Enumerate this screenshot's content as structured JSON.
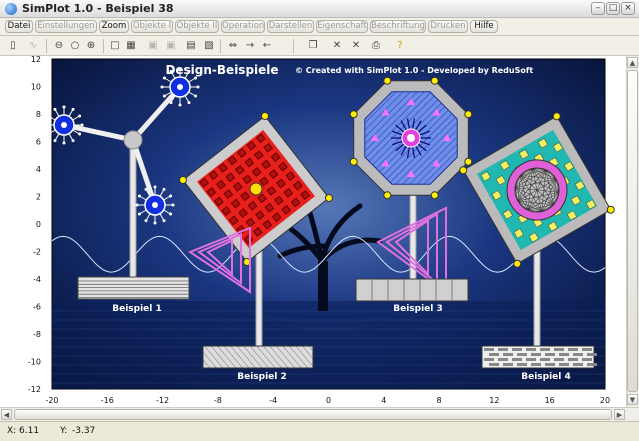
{
  "window": {
    "title": "SimPlot 1.0 - Beispiel 38"
  },
  "menu": {
    "items": [
      {
        "label": "Datei",
        "enabled": true
      },
      {
        "label": "Einstellungen",
        "enabled": false
      },
      {
        "label": "Zoom",
        "enabled": true
      },
      {
        "label": "Objekte I",
        "enabled": false
      },
      {
        "label": "Objekte II",
        "enabled": false
      },
      {
        "label": "Operation",
        "enabled": false
      },
      {
        "label": "Darstellen",
        "enabled": false
      },
      {
        "label": "Eigenschaft",
        "enabled": false
      },
      {
        "label": "Beschriftung",
        "enabled": false
      },
      {
        "label": "Drucken",
        "enabled": false
      },
      {
        "label": "Hilfe",
        "enabled": true
      }
    ]
  },
  "toolbar": {
    "icons": [
      "phone-icon",
      "wave-icon",
      "zoom-out-icon",
      "zoom-fit-icon",
      "zoom-in-icon",
      "square-icon",
      "grid-icon",
      "layers-icon",
      "layers2-icon",
      "table-icon",
      "picture-icon",
      "move-icon",
      "arrow-right-icon",
      "arrow-left-icon",
      "copy-icon",
      "delete-icon",
      "delete2-icon",
      "print-icon",
      "help-icon"
    ]
  },
  "plot": {
    "title": "Design-Beispiele",
    "credit": "© Created with SimPlot 1.0 - Developed by ReduSoft",
    "labels": [
      "Beispiel 1",
      "Beispiel 2",
      "Beispiel 3",
      "Beispiel 4"
    ],
    "x_ticks": [
      "-20",
      "-16",
      "-12",
      "-8",
      "-4",
      "0",
      "4",
      "8",
      "12",
      "16",
      "20"
    ],
    "y_ticks": [
      "12",
      "10",
      "8",
      "6",
      "4",
      "2",
      "0",
      "-2",
      "-4",
      "-6",
      "-8",
      "-10",
      "-12"
    ],
    "xlim": [
      -20,
      20
    ],
    "ylim": [
      -12,
      12
    ],
    "colors": {
      "background": "#0a1a4a",
      "square": "#e8201c",
      "octagon": "#4a6ad8",
      "diamond": "#20b8b0",
      "triangle": "#e070e0"
    }
  },
  "status": {
    "x_label": "X:",
    "x_value": "6.11",
    "y_label": "Y:",
    "y_value": "-3.37"
  }
}
